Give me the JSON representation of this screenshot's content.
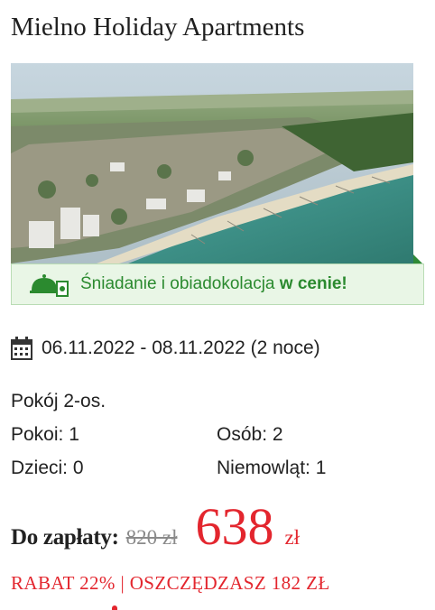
{
  "hotel": {
    "title": "Mielno Holiday Apartments"
  },
  "image": {
    "alt_icon": "beach-aerial-photo"
  },
  "promo": {
    "text_prefix": "Śniadanie i obiadokolacja",
    "text_emph": "w cenie!",
    "icon": "dining-cloche-icon",
    "color": "#2b8a2f",
    "background": "#e9f6e6"
  },
  "stay": {
    "icon": "calendar-icon",
    "dates": "06.11.2022 - 08.11.2022 (2 noce)"
  },
  "room": {
    "name": "Pokój 2-os.",
    "rooms_label": "Pokoi: 1",
    "persons_label": "Osób: 2",
    "children_label": "Dzieci: 0",
    "infants_label": "Niemowląt: 1"
  },
  "price": {
    "label": "Do zapłaty:",
    "old": "820 zł",
    "new": "638",
    "currency": "zł",
    "accent": "#e3262e"
  },
  "discount": {
    "text": "RABAT 22% | OSZCZĘDZASZ 182 ZŁ"
  }
}
